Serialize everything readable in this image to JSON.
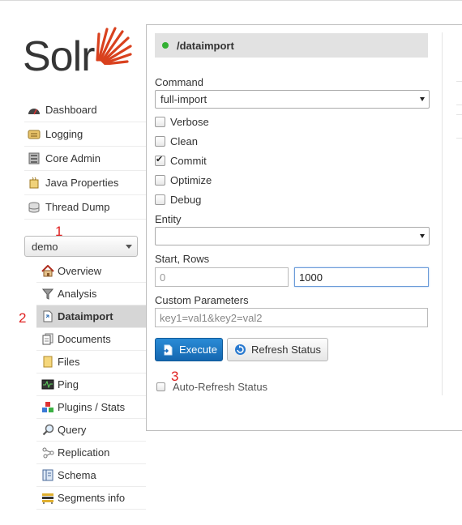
{
  "logo": {
    "text": "Solr",
    "accent": "#d9411e"
  },
  "nav": [
    {
      "label": "Dashboard",
      "icon": "dashboard-icon"
    },
    {
      "label": "Logging",
      "icon": "logging-icon"
    },
    {
      "label": "Core Admin",
      "icon": "core-admin-icon"
    },
    {
      "label": "Java Properties",
      "icon": "java-properties-icon"
    },
    {
      "label": "Thread Dump",
      "icon": "thread-dump-icon"
    }
  ],
  "core_selector": {
    "value": "demo"
  },
  "core_menu": [
    {
      "label": "Overview",
      "icon": "home-icon"
    },
    {
      "label": "Analysis",
      "icon": "funnel-icon"
    },
    {
      "label": "Dataimport",
      "icon": "dataimport-icon",
      "active": true
    },
    {
      "label": "Documents",
      "icon": "documents-icon"
    },
    {
      "label": "Files",
      "icon": "folder-icon"
    },
    {
      "label": "Ping",
      "icon": "ping-icon"
    },
    {
      "label": "Plugins / Stats",
      "icon": "plugins-icon"
    },
    {
      "label": "Query",
      "icon": "magnifier-icon"
    },
    {
      "label": "Replication",
      "icon": "replication-icon"
    },
    {
      "label": "Schema",
      "icon": "schema-icon"
    },
    {
      "label": "Segments info",
      "icon": "segments-icon"
    }
  ],
  "annotations": {
    "one": "1",
    "two": "2",
    "three": "3"
  },
  "panel": {
    "title": "/dataimport",
    "status_color": "#33b033",
    "command_label": "Command",
    "command_value": "full-import",
    "options": [
      {
        "label": "Verbose",
        "checked": false
      },
      {
        "label": "Clean",
        "checked": false
      },
      {
        "label": "Commit",
        "checked": true
      },
      {
        "label": "Optimize",
        "checked": false
      },
      {
        "label": "Debug",
        "checked": false
      }
    ],
    "entity_label": "Entity",
    "entity_value": "",
    "start_rows_label": "Start, Rows",
    "start_value": "0",
    "rows_value": "1000",
    "custom_params_label": "Custom Parameters",
    "custom_params_value": "key1=val1&key2=val2",
    "execute_label": "Execute",
    "refresh_label": "Refresh Status",
    "auto_refresh_label": "Auto-Refresh Status",
    "auto_refresh_checked": false
  }
}
